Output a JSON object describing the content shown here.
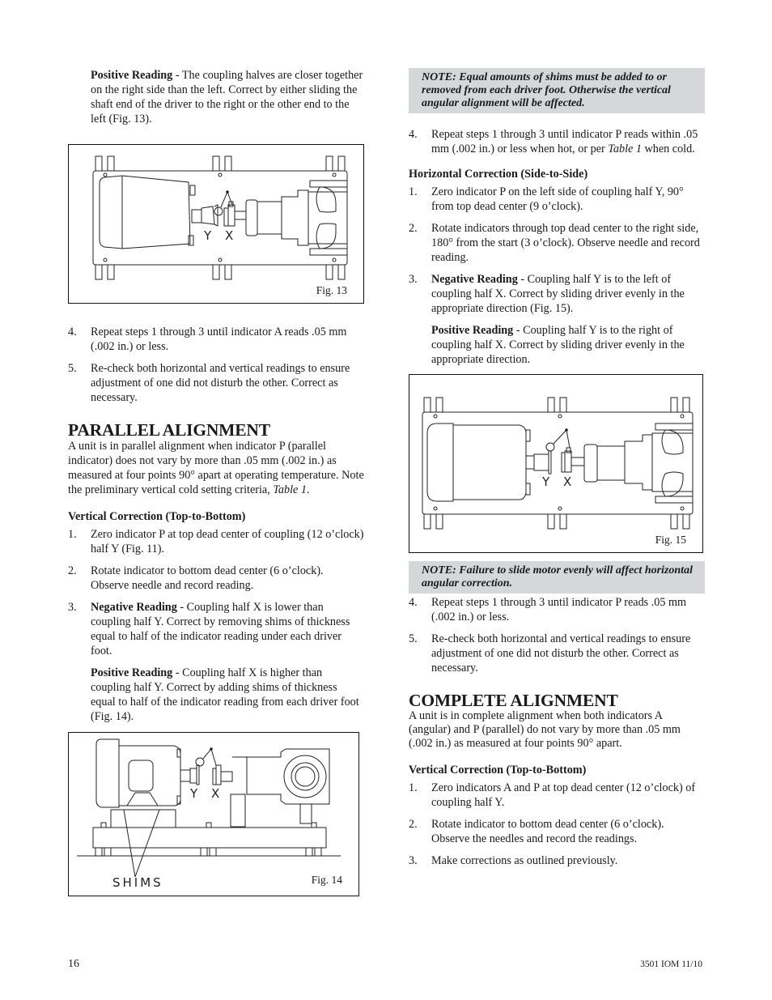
{
  "page": {
    "page_number": "16",
    "doc_code": "3501 IOM 11/10"
  },
  "left_column": {
    "positive_reading_intro": {
      "label": "Positive Reading",
      "text": " - The coupling halves are closer together on the right side than the left. Correct by either sliding the shaft end of the driver to the right or the other end to the left (Fig. 13)."
    },
    "fig13": {
      "caption": "Fig. 13",
      "label_y": "Y",
      "label_x": "X"
    },
    "angular_steps": [
      {
        "num": "4.",
        "text": "Repeat steps 1 through 3 until indicator A reads .05 mm (.002 in.) or less."
      },
      {
        "num": "5.",
        "text": "Re-check both horizontal and vertical readings to ensure adjustment of one did not disturb the other. Correct as necessary."
      }
    ],
    "parallel": {
      "heading": "PARALLEL ALIGNMENT",
      "intro_text": "A unit is in parallel alignment when indicator P (parallel indicator) does not vary by more than .05 mm (.002 in.) as measured at four points 90° apart at operating temperature. Note the preliminary vertical cold setting criteria, ",
      "intro_ref": "Table 1",
      "intro_end": ".",
      "vertical_heading": "Vertical Correction (Top-to-Bottom)",
      "steps": [
        {
          "num": "1.",
          "text": "Zero indicator P at top dead center of coupling (12 o’clock) half Y (Fig. 11)."
        },
        {
          "num": "2.",
          "text": "Rotate indicator to bottom dead center (6 o’clock). Observe needle and record reading."
        },
        {
          "num": "3.",
          "label": "Negative Reading",
          "text": " - Coupling half X is lower than coupling half Y. Correct by removing shims of thickness equal to half of the indicator reading under each driver foot."
        }
      ],
      "positive": {
        "label": "Positive Reading",
        "text": " - Coupling half X is higher than coupling half Y. Correct by adding shims of thickness equal to half of the indicator reading from each driver foot (Fig. 14)."
      }
    },
    "fig14": {
      "caption": "Fig. 14",
      "label_y": "Y",
      "label_x": "X",
      "shims_label": "SHIMS"
    }
  },
  "right_column": {
    "note_shims": "NOTE: Equal amounts of shims must be added to or removed from each driver foot. Otherwise the vertical angular alignment will be affected.",
    "step4_vertical": {
      "num": "4.",
      "text_before": "Repeat steps 1 through 3 until indicator P reads within .05 mm (.002 in.) or less when hot, or per ",
      "ref": "Table 1",
      "text_after": " when cold."
    },
    "horizontal": {
      "heading": "Horizontal Correction (Side-to-Side)",
      "steps": [
        {
          "num": "1.",
          "text": "Zero indicator P on the left side of coupling half Y, 90° from top dead center (9 o’clock)."
        },
        {
          "num": "2.",
          "text": "Rotate indicators through top dead center to the right side, 180° from the start (3 o’clock). Observe needle and record reading."
        },
        {
          "num": "3.",
          "label": "Negative Reading",
          "text": " - Coupling half Y is to the left of coupling half X. Correct by sliding driver evenly in the appropriate direction (Fig. 15)."
        }
      ],
      "positive": {
        "label": "Positive Reading",
        "text": " - Coupling half Y is to the right of coupling half X. Correct by sliding driver evenly in the appropriate direction."
      }
    },
    "fig15": {
      "caption": "Fig. 15",
      "label_y": "Y",
      "label_x": "X"
    },
    "note_motor": "NOTE: Failure to slide motor evenly will affect horizontal angular correction.",
    "final_steps": [
      {
        "num": "4.",
        "text": "Repeat steps 1 through 3 until indicator P reads .05 mm (.002 in.) or less."
      },
      {
        "num": "5.",
        "text": "Re-check both horizontal and vertical readings to ensure adjustment of one did not disturb the other. Correct as necessary."
      }
    ],
    "complete": {
      "heading": "COMPLETE ALIGNMENT",
      "intro": "A unit is in complete alignment when both indicators A (angular) and P (parallel) do not vary by more than .05 mm (.002 in.) as measured at four points 90° apart.",
      "vertical_heading": "Vertical Correction (Top-to-Bottom)",
      "steps": [
        {
          "num": "1.",
          "text": "Zero indicators A and P at top dead center (12 o’clock) of coupling half Y."
        },
        {
          "num": "2.",
          "text": "Rotate indicator to bottom dead center (6 o’clock). Observe the needles and record the readings."
        },
        {
          "num": "3.",
          "text": "Make corrections as outlined previously."
        }
      ]
    }
  }
}
